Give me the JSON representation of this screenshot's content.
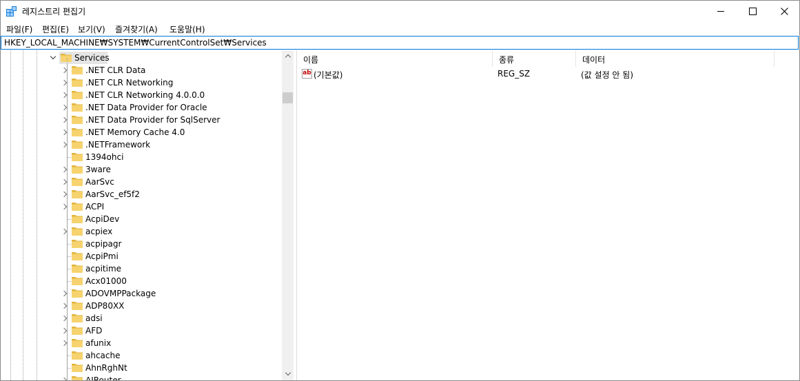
{
  "window": {
    "title": "레지스트리 편집기"
  },
  "menu": [
    "파일(F)",
    "편집(E)",
    "보기(V)",
    "즐겨찾기(A)",
    "도움말(H)"
  ],
  "address": "HKEY_LOCAL_MACHINE₩SYSTEM₩CurrentControlSet₩Services",
  "tree": {
    "selected": "Services",
    "children": [
      {
        "label": ".NET CLR Data",
        "expandable": true
      },
      {
        "label": ".NET CLR Networking",
        "expandable": true
      },
      {
        "label": ".NET CLR Networking 4.0.0.0",
        "expandable": true
      },
      {
        "label": ".NET Data Provider for Oracle",
        "expandable": true
      },
      {
        "label": ".NET Data Provider for SqlServer",
        "expandable": true
      },
      {
        "label": ".NET Memory Cache 4.0",
        "expandable": true
      },
      {
        "label": ".NETFramework",
        "expandable": true
      },
      {
        "label": "1394ohci",
        "expandable": false
      },
      {
        "label": "3ware",
        "expandable": true
      },
      {
        "label": "AarSvc",
        "expandable": true
      },
      {
        "label": "AarSvc_ef5f2",
        "expandable": true
      },
      {
        "label": "ACPI",
        "expandable": true
      },
      {
        "label": "AcpiDev",
        "expandable": false
      },
      {
        "label": "acpiex",
        "expandable": true
      },
      {
        "label": "acpipagr",
        "expandable": false
      },
      {
        "label": "AcpiPmi",
        "expandable": false
      },
      {
        "label": "acpitime",
        "expandable": false
      },
      {
        "label": "Acx01000",
        "expandable": false
      },
      {
        "label": "ADOVMPPackage",
        "expandable": true
      },
      {
        "label": "ADP80XX",
        "expandable": true
      },
      {
        "label": "adsi",
        "expandable": true
      },
      {
        "label": "AFD",
        "expandable": true
      },
      {
        "label": "afunix",
        "expandable": true
      },
      {
        "label": "ahcache",
        "expandable": false
      },
      {
        "label": "AhnRghNt",
        "expandable": false
      },
      {
        "label": "AJRouter",
        "expandable": true
      }
    ]
  },
  "list": {
    "columns": [
      "이름",
      "종류",
      "데이터"
    ],
    "rows": [
      {
        "name": "(기본값)",
        "type": "REG_SZ",
        "data": "(값 설정 안 됨)",
        "icon": "string-value-icon"
      }
    ]
  },
  "colors": {
    "folder": "#f6d36e",
    "folder_dark": "#e2b53f",
    "accent": "#0078d7"
  }
}
